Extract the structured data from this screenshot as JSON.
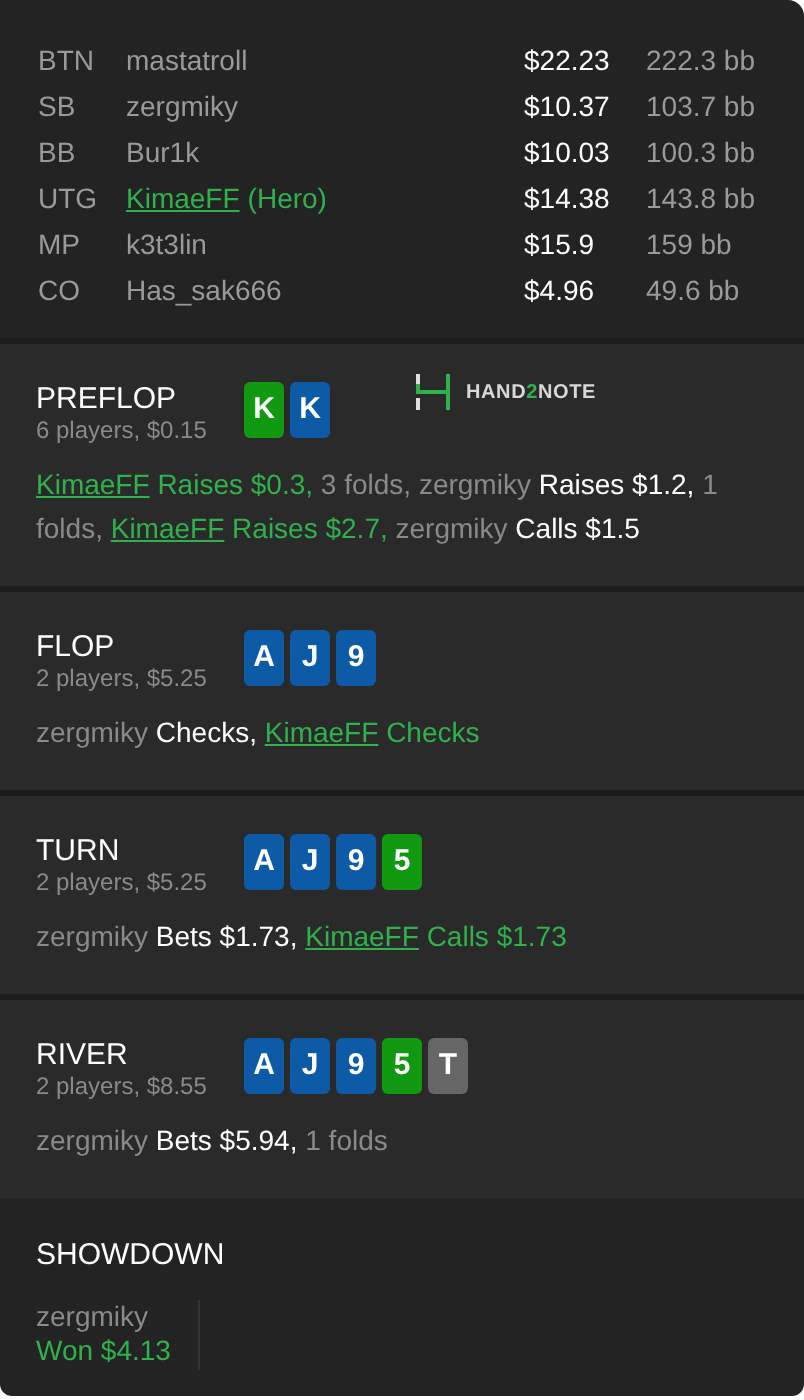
{
  "players": [
    {
      "position": "BTN",
      "name": "mastatroll",
      "is_hero": false,
      "stack": "$22.23",
      "bb": "222.3 bb"
    },
    {
      "position": "SB",
      "name": "zergmiky",
      "is_hero": false,
      "stack": "$10.37",
      "bb": "103.7 bb"
    },
    {
      "position": "BB",
      "name": "Bur1k",
      "is_hero": false,
      "stack": "$10.03",
      "bb": "100.3 bb"
    },
    {
      "position": "UTG",
      "name": "KimaeFF",
      "is_hero": true,
      "hero_tag": "(Hero)",
      "stack": "$14.38",
      "bb": "143.8 bb"
    },
    {
      "position": "MP",
      "name": "k3t3lin",
      "is_hero": false,
      "stack": "$15.9",
      "bb": "159 bb"
    },
    {
      "position": "CO",
      "name": "Has_sak666",
      "is_hero": false,
      "stack": "$4.96",
      "bb": "49.6 bb"
    }
  ],
  "streets": [
    {
      "name": "PREFLOP",
      "info": "6 players, $0.15",
      "cards": [
        {
          "rank": "K",
          "color": "#119a11"
        },
        {
          "rank": "K",
          "color": "#0d5aa7"
        }
      ],
      "logo": {
        "before": "HAND",
        "accent": "2",
        "after": "NOTE"
      },
      "actions": [
        {
          "kind": "hero",
          "player": "KimaeFF",
          "text": "Raises $0.3,"
        },
        {
          "kind": "folds",
          "text": "3 folds,"
        },
        {
          "kind": "player",
          "player": "zergmiky",
          "text": "Raises $1.2,"
        },
        {
          "kind": "folds",
          "text": "1 folds,"
        },
        {
          "kind": "hero",
          "player": "KimaeFF",
          "text": "Raises $2.7,"
        },
        {
          "kind": "player",
          "player": "zergmiky",
          "text": "Calls $1.5"
        }
      ]
    },
    {
      "name": "FLOP",
      "info": "2 players, $5.25",
      "cards": [
        {
          "rank": "A",
          "color": "#0d5aa7"
        },
        {
          "rank": "J",
          "color": "#0d5aa7"
        },
        {
          "rank": "9",
          "color": "#0d5aa7"
        }
      ],
      "actions": [
        {
          "kind": "player",
          "player": "zergmiky",
          "text": "Checks,"
        },
        {
          "kind": "hero",
          "player": "KimaeFF",
          "text": "Checks"
        }
      ]
    },
    {
      "name": "TURN",
      "info": "2 players, $5.25",
      "cards": [
        {
          "rank": "A",
          "color": "#0d5aa7"
        },
        {
          "rank": "J",
          "color": "#0d5aa7"
        },
        {
          "rank": "9",
          "color": "#0d5aa7"
        },
        {
          "rank": "5",
          "color": "#119a11"
        }
      ],
      "actions": [
        {
          "kind": "player",
          "player": "zergmiky",
          "text": "Bets $1.73,"
        },
        {
          "kind": "hero",
          "player": "KimaeFF",
          "text": "Calls $1.73"
        }
      ]
    },
    {
      "name": "RIVER",
      "info": "2 players, $8.55",
      "cards": [
        {
          "rank": "A",
          "color": "#0d5aa7"
        },
        {
          "rank": "J",
          "color": "#0d5aa7"
        },
        {
          "rank": "9",
          "color": "#0d5aa7"
        },
        {
          "rank": "5",
          "color": "#119a11"
        },
        {
          "rank": "T",
          "color": "#666666"
        }
      ],
      "actions": [
        {
          "kind": "player",
          "player": "zergmiky",
          "text": "Bets $5.94,"
        },
        {
          "kind": "folds",
          "text": "1 folds"
        }
      ]
    }
  ],
  "showdown": {
    "title": "SHOWDOWN",
    "winners": [
      {
        "player": "zergmiky",
        "result": "Won $4.13"
      }
    ]
  }
}
